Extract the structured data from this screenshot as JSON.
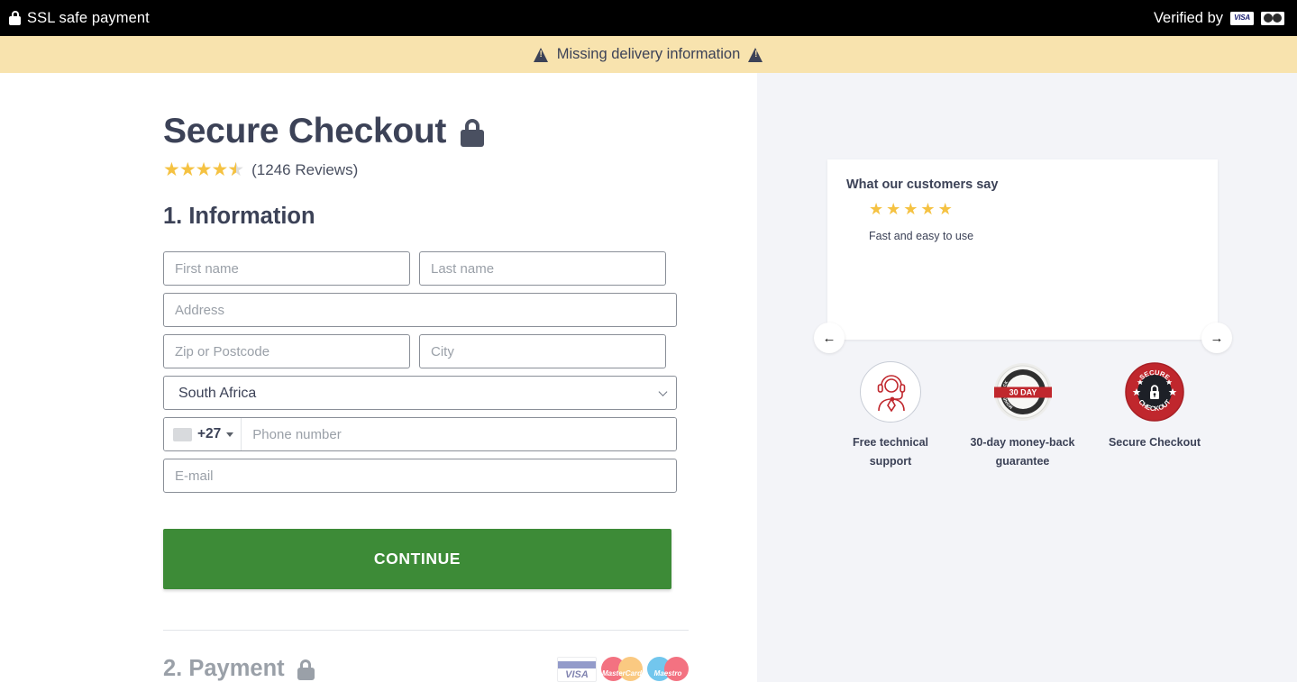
{
  "topbar": {
    "ssl_label": "SSL safe payment",
    "lock_icon": "lock-icon",
    "verified_label": "Verified by",
    "visa_label": "VISA",
    "mastercard_icon": "mastercard-icon"
  },
  "warning": {
    "message": "Missing delivery information",
    "icon": "warning-triangle-icon",
    "bg_color": "#f8e3ae",
    "text_color": "#3c4257"
  },
  "heading": {
    "title": "Secure Checkout",
    "lock_icon": "lock-icon",
    "rating_value": 4.5,
    "stars": [
      "full",
      "full",
      "full",
      "full",
      "half"
    ],
    "reviews_label": "(1246 Reviews)"
  },
  "section": {
    "information_title": "1. Information",
    "payment_title": "2. Payment"
  },
  "form": {
    "first_name": {
      "placeholder": "First name",
      "value": ""
    },
    "last_name": {
      "placeholder": "Last name",
      "value": ""
    },
    "address": {
      "placeholder": "Address",
      "value": ""
    },
    "zip": {
      "placeholder": "Zip or Postcode",
      "value": ""
    },
    "city": {
      "placeholder": "City",
      "value": ""
    },
    "country": {
      "selected": "South Africa"
    },
    "phone": {
      "dial_code": "+27",
      "placeholder": "Phone number",
      "value": "",
      "flag_icon": "flag-placeholder-icon",
      "caret_icon": "caret-down-icon"
    },
    "email": {
      "placeholder": "E-mail",
      "value": ""
    },
    "continue_label": "CONTINUE",
    "continue_color": "#3d8b37"
  },
  "payment_logos": {
    "visa": "VISA",
    "mastercard": "MasterCard",
    "maestro": "Maestro"
  },
  "testimonial": {
    "heading": "What our customers say",
    "stars": 5,
    "quote": "Fast and easy to use",
    "prev_icon": "arrow-left-icon",
    "next_icon": "arrow-right-icon",
    "prev_glyph": "←",
    "next_glyph": "→"
  },
  "badges": [
    {
      "icon": "headset-support-icon",
      "label_line1": "Free technical",
      "label_line2": "support"
    },
    {
      "icon": "money-back-seal-icon",
      "seal_text": "30 DAY",
      "seal_top_text": "MONEY BACK",
      "seal_bottom_text": "GUARANTEE",
      "label_line1": "30-day money-back",
      "label_line2": "guarantee"
    },
    {
      "icon": "secure-checkout-seal-icon",
      "seal_top_text": "SECURE",
      "seal_bottom_text": "CHECKOUT",
      "label_line1": "Secure Checkout",
      "label_line2": ""
    }
  ],
  "colors": {
    "accent_green": "#3d8b37",
    "star_yellow": "#f5c242",
    "text_dark": "#3c4257",
    "panel_bg": "#f3f4f8",
    "seal_red": "#c0272d"
  }
}
